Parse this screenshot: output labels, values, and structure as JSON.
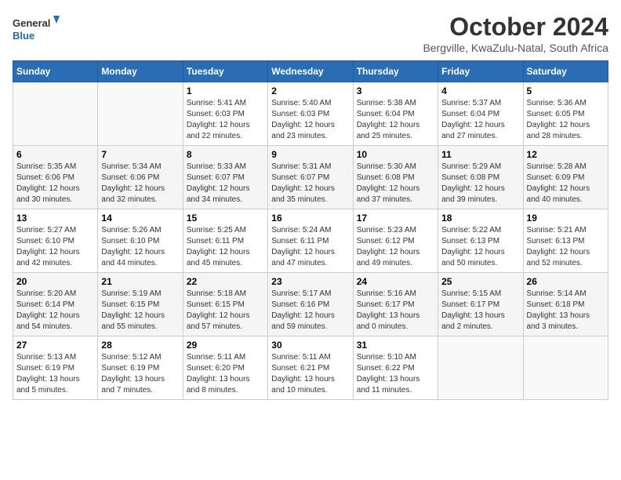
{
  "logo": {
    "line1": "General",
    "line2": "Blue"
  },
  "title": "October 2024",
  "subtitle": "Bergville, KwaZulu-Natal, South Africa",
  "weekdays": [
    "Sunday",
    "Monday",
    "Tuesday",
    "Wednesday",
    "Thursday",
    "Friday",
    "Saturday"
  ],
  "weeks": [
    [
      {
        "day": "",
        "info": ""
      },
      {
        "day": "",
        "info": ""
      },
      {
        "day": "1",
        "info": "Sunrise: 5:41 AM\nSunset: 6:03 PM\nDaylight: 12 hours and 22 minutes."
      },
      {
        "day": "2",
        "info": "Sunrise: 5:40 AM\nSunset: 6:03 PM\nDaylight: 12 hours and 23 minutes."
      },
      {
        "day": "3",
        "info": "Sunrise: 5:38 AM\nSunset: 6:04 PM\nDaylight: 12 hours and 25 minutes."
      },
      {
        "day": "4",
        "info": "Sunrise: 5:37 AM\nSunset: 6:04 PM\nDaylight: 12 hours and 27 minutes."
      },
      {
        "day": "5",
        "info": "Sunrise: 5:36 AM\nSunset: 6:05 PM\nDaylight: 12 hours and 28 minutes."
      }
    ],
    [
      {
        "day": "6",
        "info": "Sunrise: 5:35 AM\nSunset: 6:06 PM\nDaylight: 12 hours and 30 minutes."
      },
      {
        "day": "7",
        "info": "Sunrise: 5:34 AM\nSunset: 6:06 PM\nDaylight: 12 hours and 32 minutes."
      },
      {
        "day": "8",
        "info": "Sunrise: 5:33 AM\nSunset: 6:07 PM\nDaylight: 12 hours and 34 minutes."
      },
      {
        "day": "9",
        "info": "Sunrise: 5:31 AM\nSunset: 6:07 PM\nDaylight: 12 hours and 35 minutes."
      },
      {
        "day": "10",
        "info": "Sunrise: 5:30 AM\nSunset: 6:08 PM\nDaylight: 12 hours and 37 minutes."
      },
      {
        "day": "11",
        "info": "Sunrise: 5:29 AM\nSunset: 6:08 PM\nDaylight: 12 hours and 39 minutes."
      },
      {
        "day": "12",
        "info": "Sunrise: 5:28 AM\nSunset: 6:09 PM\nDaylight: 12 hours and 40 minutes."
      }
    ],
    [
      {
        "day": "13",
        "info": "Sunrise: 5:27 AM\nSunset: 6:10 PM\nDaylight: 12 hours and 42 minutes."
      },
      {
        "day": "14",
        "info": "Sunrise: 5:26 AM\nSunset: 6:10 PM\nDaylight: 12 hours and 44 minutes."
      },
      {
        "day": "15",
        "info": "Sunrise: 5:25 AM\nSunset: 6:11 PM\nDaylight: 12 hours and 45 minutes."
      },
      {
        "day": "16",
        "info": "Sunrise: 5:24 AM\nSunset: 6:11 PM\nDaylight: 12 hours and 47 minutes."
      },
      {
        "day": "17",
        "info": "Sunrise: 5:23 AM\nSunset: 6:12 PM\nDaylight: 12 hours and 49 minutes."
      },
      {
        "day": "18",
        "info": "Sunrise: 5:22 AM\nSunset: 6:13 PM\nDaylight: 12 hours and 50 minutes."
      },
      {
        "day": "19",
        "info": "Sunrise: 5:21 AM\nSunset: 6:13 PM\nDaylight: 12 hours and 52 minutes."
      }
    ],
    [
      {
        "day": "20",
        "info": "Sunrise: 5:20 AM\nSunset: 6:14 PM\nDaylight: 12 hours and 54 minutes."
      },
      {
        "day": "21",
        "info": "Sunrise: 5:19 AM\nSunset: 6:15 PM\nDaylight: 12 hours and 55 minutes."
      },
      {
        "day": "22",
        "info": "Sunrise: 5:18 AM\nSunset: 6:15 PM\nDaylight: 12 hours and 57 minutes."
      },
      {
        "day": "23",
        "info": "Sunrise: 5:17 AM\nSunset: 6:16 PM\nDaylight: 12 hours and 59 minutes."
      },
      {
        "day": "24",
        "info": "Sunrise: 5:16 AM\nSunset: 6:17 PM\nDaylight: 13 hours and 0 minutes."
      },
      {
        "day": "25",
        "info": "Sunrise: 5:15 AM\nSunset: 6:17 PM\nDaylight: 13 hours and 2 minutes."
      },
      {
        "day": "26",
        "info": "Sunrise: 5:14 AM\nSunset: 6:18 PM\nDaylight: 13 hours and 3 minutes."
      }
    ],
    [
      {
        "day": "27",
        "info": "Sunrise: 5:13 AM\nSunset: 6:19 PM\nDaylight: 13 hours and 5 minutes."
      },
      {
        "day": "28",
        "info": "Sunrise: 5:12 AM\nSunset: 6:19 PM\nDaylight: 13 hours and 7 minutes."
      },
      {
        "day": "29",
        "info": "Sunrise: 5:11 AM\nSunset: 6:20 PM\nDaylight: 13 hours and 8 minutes."
      },
      {
        "day": "30",
        "info": "Sunrise: 5:11 AM\nSunset: 6:21 PM\nDaylight: 13 hours and 10 minutes."
      },
      {
        "day": "31",
        "info": "Sunrise: 5:10 AM\nSunset: 6:22 PM\nDaylight: 13 hours and 11 minutes."
      },
      {
        "day": "",
        "info": ""
      },
      {
        "day": "",
        "info": ""
      }
    ]
  ]
}
